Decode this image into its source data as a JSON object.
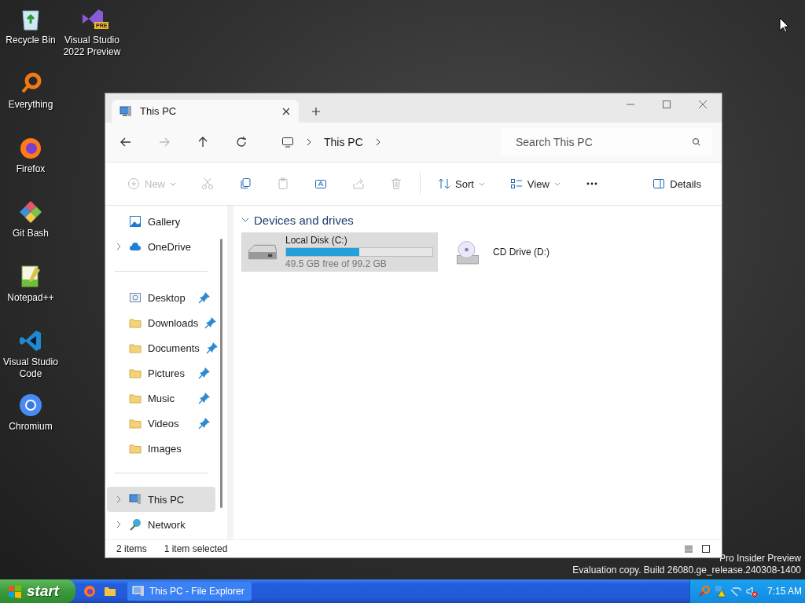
{
  "desktop": {
    "columns": [
      {
        "icons": [
          {
            "label": "Recycle Bin",
            "kind": "recycle"
          },
          {
            "label": "Everything",
            "kind": "everything"
          },
          {
            "label": "Firefox",
            "kind": "firefox"
          },
          {
            "label": "Git Bash",
            "kind": "git"
          },
          {
            "label": "Notepad++",
            "kind": "notepad"
          },
          {
            "label": "Visual Studio Code",
            "kind": "vscode"
          },
          {
            "label": "Chromium",
            "kind": "chromium"
          }
        ]
      },
      {
        "icons": [
          {
            "label": "Visual Studio 2022 Preview",
            "kind": "vs",
            "badge": "PRE"
          }
        ]
      }
    ]
  },
  "window": {
    "tab": {
      "title": "This PC"
    },
    "nav": [
      {
        "kind": "back",
        "disabled": false
      },
      {
        "kind": "forward",
        "disabled": true
      },
      {
        "kind": "up",
        "disabled": false
      },
      {
        "kind": "refresh",
        "disabled": false
      }
    ],
    "breadcrumb": [
      "This PC"
    ],
    "search": {
      "placeholder": "Search This PC"
    },
    "commands": [
      {
        "kind": "new",
        "label": "New",
        "disabled": true,
        "dropdown": true
      },
      {
        "kind": "cut",
        "disabled": true
      },
      {
        "kind": "copy",
        "disabled": false
      },
      {
        "kind": "paste",
        "disabled": true
      },
      {
        "kind": "rename",
        "disabled": false
      },
      {
        "kind": "share",
        "disabled": true
      },
      {
        "kind": "delete",
        "disabled": true
      },
      {
        "kind": "sort",
        "label": "Sort",
        "disabled": false,
        "dropdown": true
      },
      {
        "kind": "view",
        "label": "View",
        "disabled": false,
        "dropdown": true
      },
      {
        "kind": "more",
        "disabled": false
      }
    ],
    "details_button": "Details",
    "sidebar": {
      "groups": [
        {
          "items": [
            {
              "label": "Gallery",
              "kind": "gallery",
              "expandable": false,
              "pinned": false,
              "selected": false
            },
            {
              "label": "OneDrive",
              "kind": "cloud",
              "expandable": true,
              "pinned": false,
              "selected": false
            }
          ]
        },
        {
          "items": [
            {
              "label": "Desktop",
              "kind": "desktop",
              "expandable": false,
              "pinned": true,
              "selected": false
            },
            {
              "label": "Downloads",
              "kind": "folder",
              "expandable": false,
              "pinned": true,
              "selected": false
            },
            {
              "label": "Documents",
              "kind": "folder",
              "expandable": false,
              "pinned": true,
              "selected": false
            },
            {
              "label": "Pictures",
              "kind": "folder",
              "expandable": false,
              "pinned": true,
              "selected": false
            },
            {
              "label": "Music",
              "kind": "folder",
              "expandable": false,
              "pinned": true,
              "selected": false
            },
            {
              "label": "Videos",
              "kind": "folder",
              "expandable": false,
              "pinned": true,
              "selected": false
            },
            {
              "label": "Images",
              "kind": "folder",
              "expandable": false,
              "pinned": false,
              "selected": false
            }
          ]
        },
        {
          "items": [
            {
              "label": "This PC",
              "kind": "pc",
              "expandable": true,
              "pinned": false,
              "selected": true
            },
            {
              "label": "Network",
              "kind": "network",
              "expandable": true,
              "pinned": false,
              "selected": false
            }
          ]
        }
      ]
    },
    "section": {
      "title": "Devices and drives",
      "expanded": true
    },
    "drives": [
      {
        "name": "Local Disk (C:)",
        "kind": "disk",
        "level": 0.5,
        "space": "49.5 GB free of 99.2 GB",
        "selected": true
      },
      {
        "name": "CD Drive (D:)",
        "kind": "cd",
        "selected": false
      }
    ],
    "status": [
      "2 items",
      "1 item selected"
    ]
  },
  "watermark": [
    "Pro Insider Preview",
    "Evaluation copy. Build 26080.ge_release.240308-1400"
  ],
  "taskbar": {
    "start": "start",
    "tasks": [
      {
        "label": "This PC - File Explorer",
        "selected": false
      }
    ],
    "clock": "7:15 AM"
  }
}
